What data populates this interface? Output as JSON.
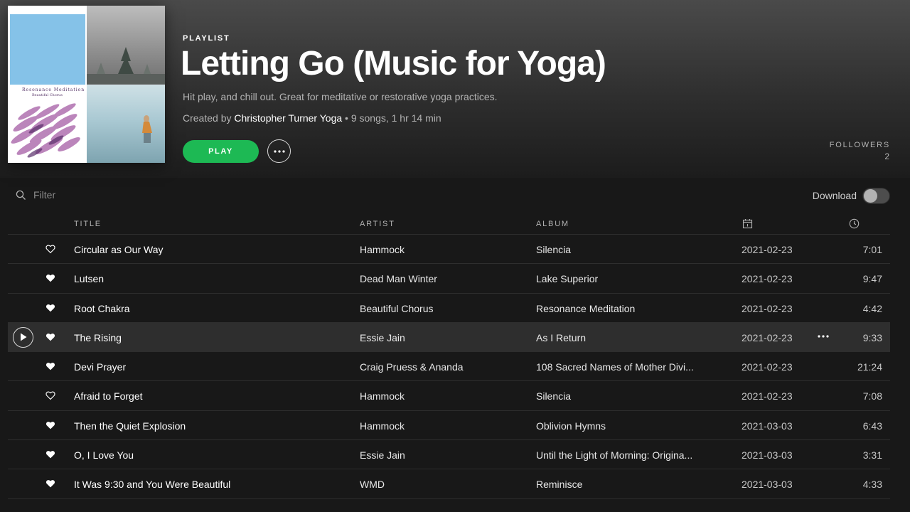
{
  "header": {
    "kind": "PLAYLIST",
    "title": "Letting Go (Music for Yoga)",
    "description": "Hit play, and chill out. Great for meditative or restorative yoga practices.",
    "created_by_prefix": "Created by",
    "owner": "Christopher Turner Yoga",
    "stats": " • 9 songs, 1 hr 14 min",
    "play_label": "PLAY",
    "followers_label": "FOLLOWERS",
    "followers_count": "2"
  },
  "cover": {
    "tile3_title": "Resonance Meditation",
    "tile3_subtitle": "Beautiful Chorus"
  },
  "toolbar": {
    "filter_placeholder": "Filter",
    "download_label": "Download",
    "download_enabled": false
  },
  "columns": {
    "title": "TITLE",
    "artist": "ARTIST",
    "album": "ALBUM",
    "date_icon": "calendar-icon",
    "duration_icon": "clock-icon"
  },
  "tracks": [
    {
      "title": "Circular as Our Way",
      "artist": "Hammock",
      "album": "Silencia",
      "date": "2021-02-23",
      "duration": "7:01",
      "liked": false
    },
    {
      "title": "Lutsen",
      "artist": "Dead Man Winter",
      "album": "Lake Superior",
      "date": "2021-02-23",
      "duration": "9:47",
      "liked": true
    },
    {
      "title": "Root Chakra",
      "artist": "Beautiful Chorus",
      "album": "Resonance Meditation",
      "date": "2021-02-23",
      "duration": "4:42",
      "liked": true
    },
    {
      "title": "The Rising",
      "artist": "Essie Jain",
      "album": "As I Return",
      "date": "2021-02-23",
      "duration": "9:33",
      "liked": true,
      "hovered": true
    },
    {
      "title": "Devi Prayer",
      "artist": "Craig Pruess & Ananda",
      "album": "108 Sacred Names of Mother Divi...",
      "date": "2021-02-23",
      "duration": "21:24",
      "liked": true
    },
    {
      "title": "Afraid to Forget",
      "artist": "Hammock",
      "album": "Silencia",
      "date": "2021-02-23",
      "duration": "7:08",
      "liked": false
    },
    {
      "title": "Then the Quiet Explosion",
      "artist": "Hammock",
      "album": "Oblivion Hymns",
      "date": "2021-03-03",
      "duration": "6:43",
      "liked": true
    },
    {
      "title": "O, I Love You",
      "artist": "Essie Jain",
      "album": "Until the Light of Morning: Origina...",
      "date": "2021-03-03",
      "duration": "3:31",
      "liked": true
    },
    {
      "title": "It Was 9:30 and You Were Beautiful",
      "artist": "WMD",
      "album": "Reminisce",
      "date": "2021-03-03",
      "duration": "4:33",
      "liked": true
    }
  ],
  "colors": {
    "accent": "#1db954",
    "background": "#181818",
    "row_hover": "#2e2e2e",
    "text_secondary": "#b3b3b3"
  }
}
